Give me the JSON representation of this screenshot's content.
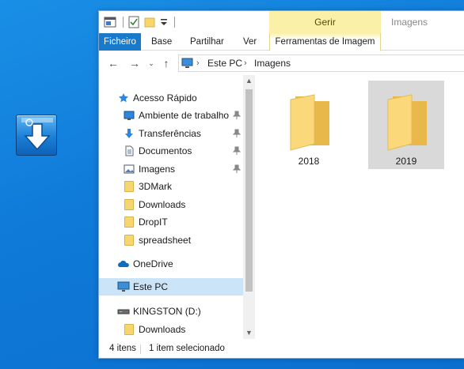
{
  "window": {
    "title": "Imagens",
    "context_group": "Gerir"
  },
  "ribbon": {
    "tabs": [
      "Ficheiro",
      "Base",
      "Partilhar",
      "Ver"
    ],
    "context_tab": "Ferramentas de Imagem",
    "file_tab_color": "#1979ca",
    "context_color": "#fbf0a8"
  },
  "address": {
    "crumbs": [
      "Este PC",
      "Imagens"
    ]
  },
  "nav": {
    "quick_access": "Acesso Rápido",
    "pinned": [
      {
        "label": "Ambiente de trabalho",
        "icon": "desktop-icon"
      },
      {
        "label": "Transferências",
        "icon": "download-arrow-icon"
      },
      {
        "label": "Documentos",
        "icon": "document-icon"
      },
      {
        "label": "Imagens",
        "icon": "pictures-icon"
      }
    ],
    "folders": [
      "3DMark",
      "Downloads",
      "DropIT",
      "spreadsheet"
    ],
    "onedrive": "OneDrive",
    "this_pc": "Este PC",
    "drive": "KINGSTON (D:)",
    "drive_folder": "Downloads"
  },
  "content": {
    "items": [
      {
        "label": "2018",
        "selected": false
      },
      {
        "label": "2019",
        "selected": true
      }
    ]
  },
  "status": {
    "count": "4 itens",
    "selection": "1 item selecionado"
  }
}
